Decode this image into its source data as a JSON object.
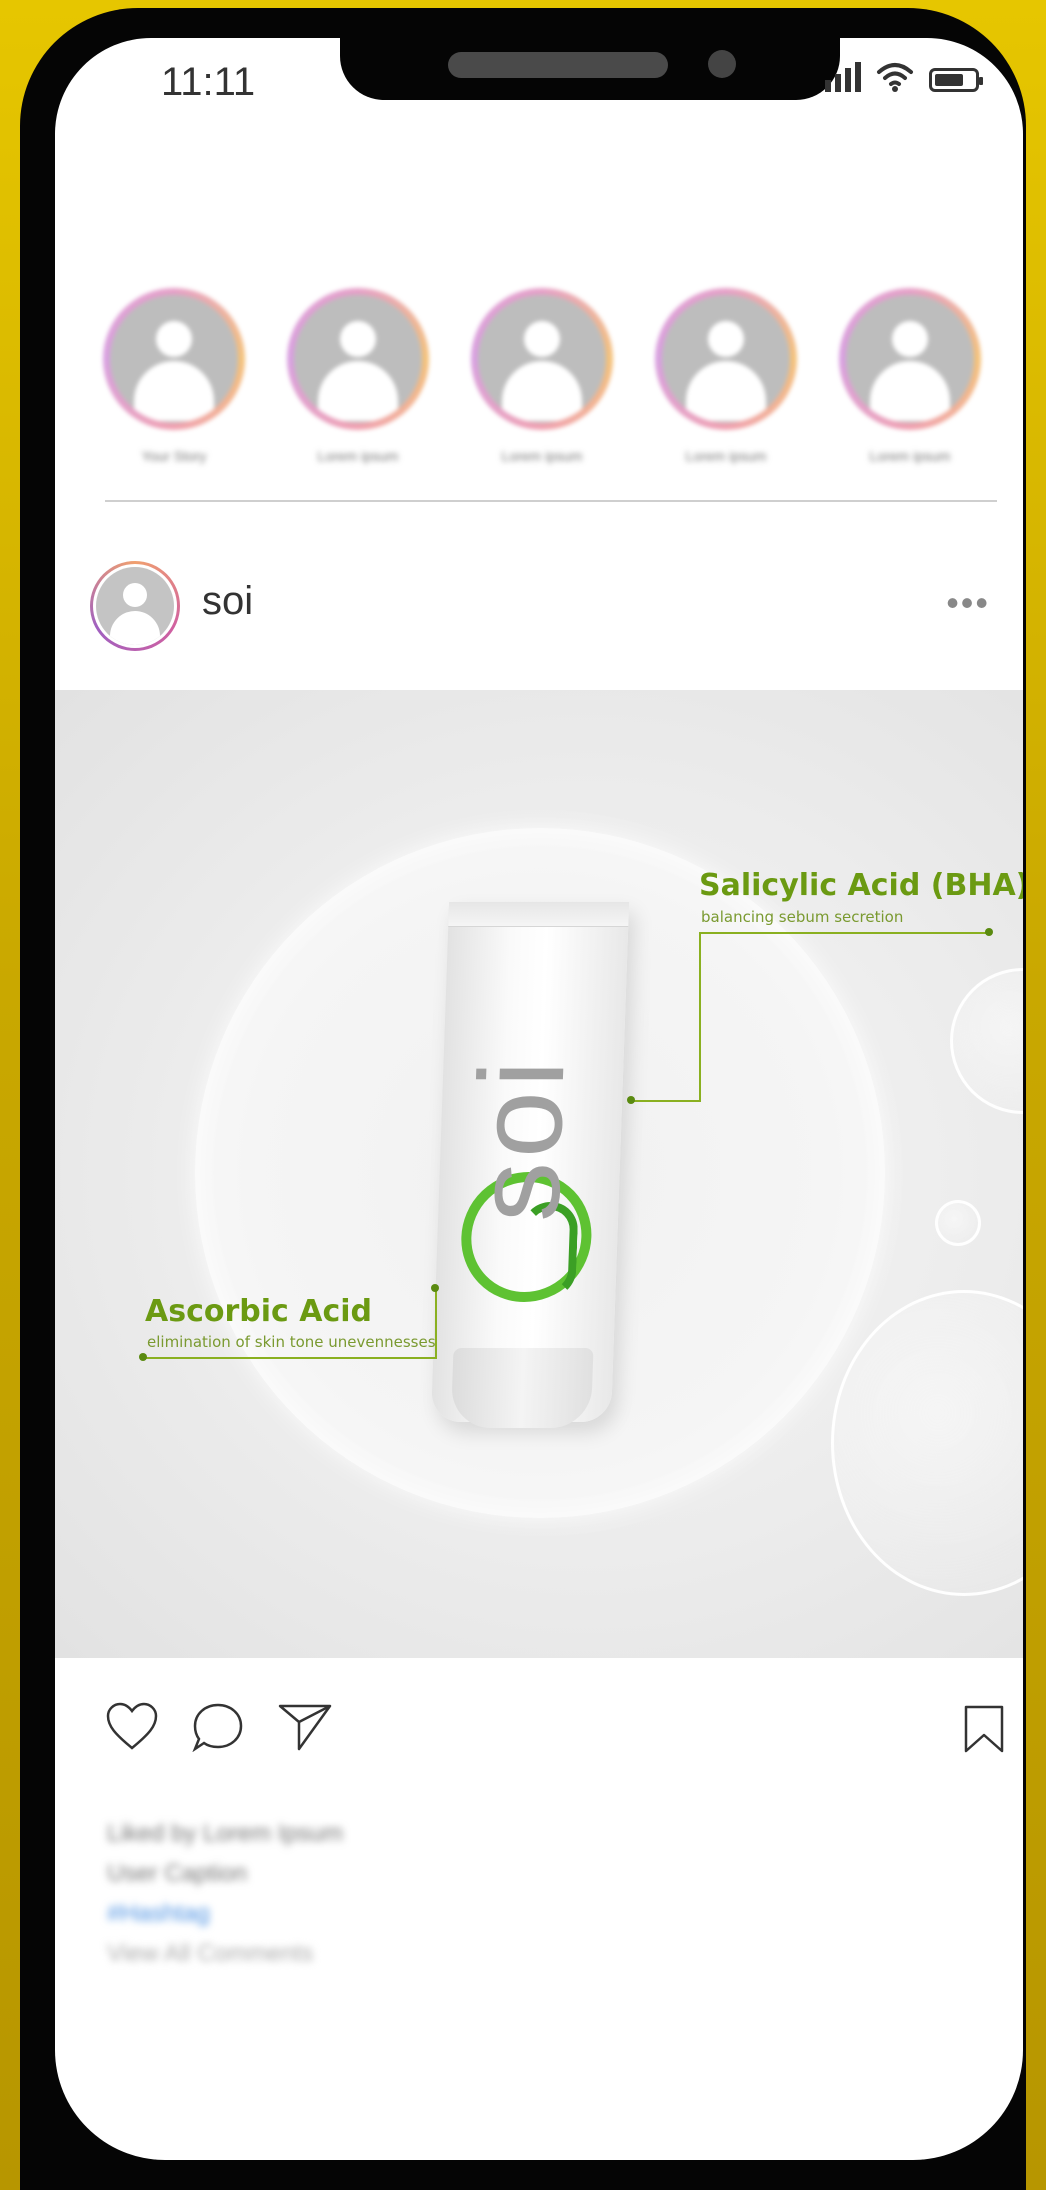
{
  "status_bar": {
    "time": "11:11"
  },
  "stories": [
    {
      "label": "Your Story"
    },
    {
      "label": "Lorem ipsum"
    },
    {
      "label": "Lorem ipsum"
    },
    {
      "label": "Lorem ipsum"
    },
    {
      "label": "Lorem ipsum"
    }
  ],
  "post": {
    "username": "soi",
    "more_label": "•••",
    "image": {
      "brand": "soi",
      "callouts": [
        {
          "title": "Salicylic Acid (BHA)",
          "subtitle": "balancing sebum secretion"
        },
        {
          "title": "Ascorbic Acid",
          "subtitle": "elimination of skin tone unevennesses"
        }
      ]
    },
    "caption": {
      "liked_by": "Liked by Lorem Ipsum",
      "user_caption": "User Caption",
      "hashtag": "#Hashtag",
      "view_comments": "View All Comments"
    }
  },
  "icons": {
    "like": "heart-icon",
    "comment": "comment-icon",
    "share": "send-icon",
    "save": "bookmark-icon"
  },
  "colors": {
    "background": "#e6c600",
    "accent_green": "#6b9a12",
    "hashtag_blue": "#4a90e2"
  }
}
